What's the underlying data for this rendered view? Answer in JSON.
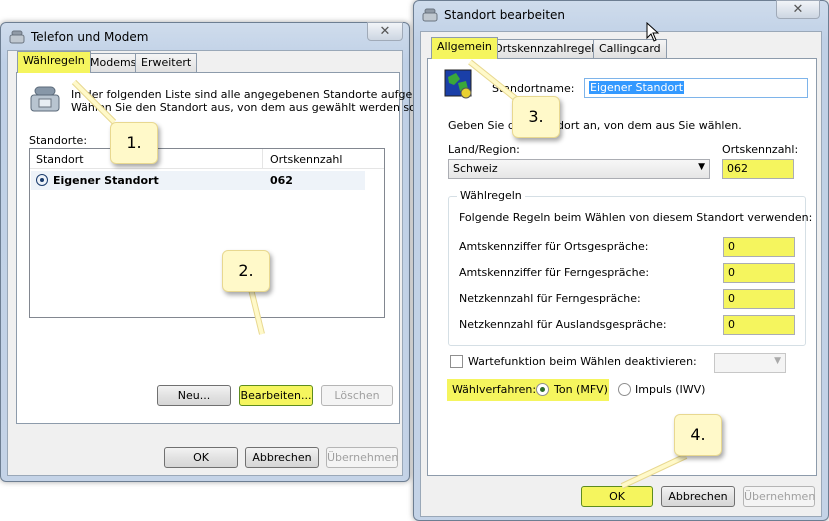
{
  "left_window": {
    "title": "Telefon und Modem",
    "tabs": [
      "Wählregeln",
      "Modems",
      "Erweitert"
    ],
    "description_line1": "In der folgenden Liste sind alle angegebenen Standorte aufgelistet.",
    "description_line2": "Wählen Sie den Standort aus, von dem aus gewählt werden soll.",
    "locations_label": "Standorte:",
    "list_headers": [
      "Standort",
      "Ortskennzahl"
    ],
    "list_rows": [
      {
        "name": "Eigener Standort",
        "code": "062"
      }
    ],
    "buttons": {
      "new": "Neu...",
      "edit": "Bearbeiten...",
      "delete": "Löschen"
    },
    "footer": {
      "ok": "OK",
      "cancel": "Abbrechen",
      "apply": "Übernehmen"
    }
  },
  "right_window": {
    "title": "Standort bearbeiten",
    "tabs": [
      "Allgemein",
      "Ortskennzahlregeln",
      "Callingcard"
    ],
    "location_name_label": "Standortname:",
    "location_name_value": "Eigener Standort",
    "hint": "Geben Sie den Standort an, von dem aus Sie wählen.",
    "country_label": "Land/Region:",
    "country_value": "Schweiz",
    "area_code_label": "Ortskennzahl:",
    "area_code_value": "062",
    "dial_rules_legend": "Wählregeln",
    "dial_rules_desc": "Folgende Regeln beim Wählen von diesem Standort verwenden:",
    "rules": [
      {
        "label": "Amtskennziffer für Ortsgespräche:",
        "value": "0"
      },
      {
        "label": "Amtskennziffer für Ferngespräche:",
        "value": "0"
      },
      {
        "label": "Netzkennzahl für Ferngespräche:",
        "value": "0"
      },
      {
        "label": "Netzkennzahl für Auslandsgespräche:",
        "value": "0"
      }
    ],
    "call_waiting_label": "Wartefunktion beim Wählen deaktivieren:",
    "dial_method_label": "Wählverfahren:",
    "dial_tone_label": "Ton (MFV)",
    "dial_pulse_label": "Impuls (IWV)",
    "footer": {
      "ok": "OK",
      "cancel": "Abbrechen",
      "apply": "Übernehmen"
    }
  },
  "callouts": [
    "1.",
    "2.",
    "3.",
    "4."
  ],
  "colors": {
    "highlight": "#f5f55e",
    "callout": "#fff9c9",
    "selection": "#3399ff"
  }
}
